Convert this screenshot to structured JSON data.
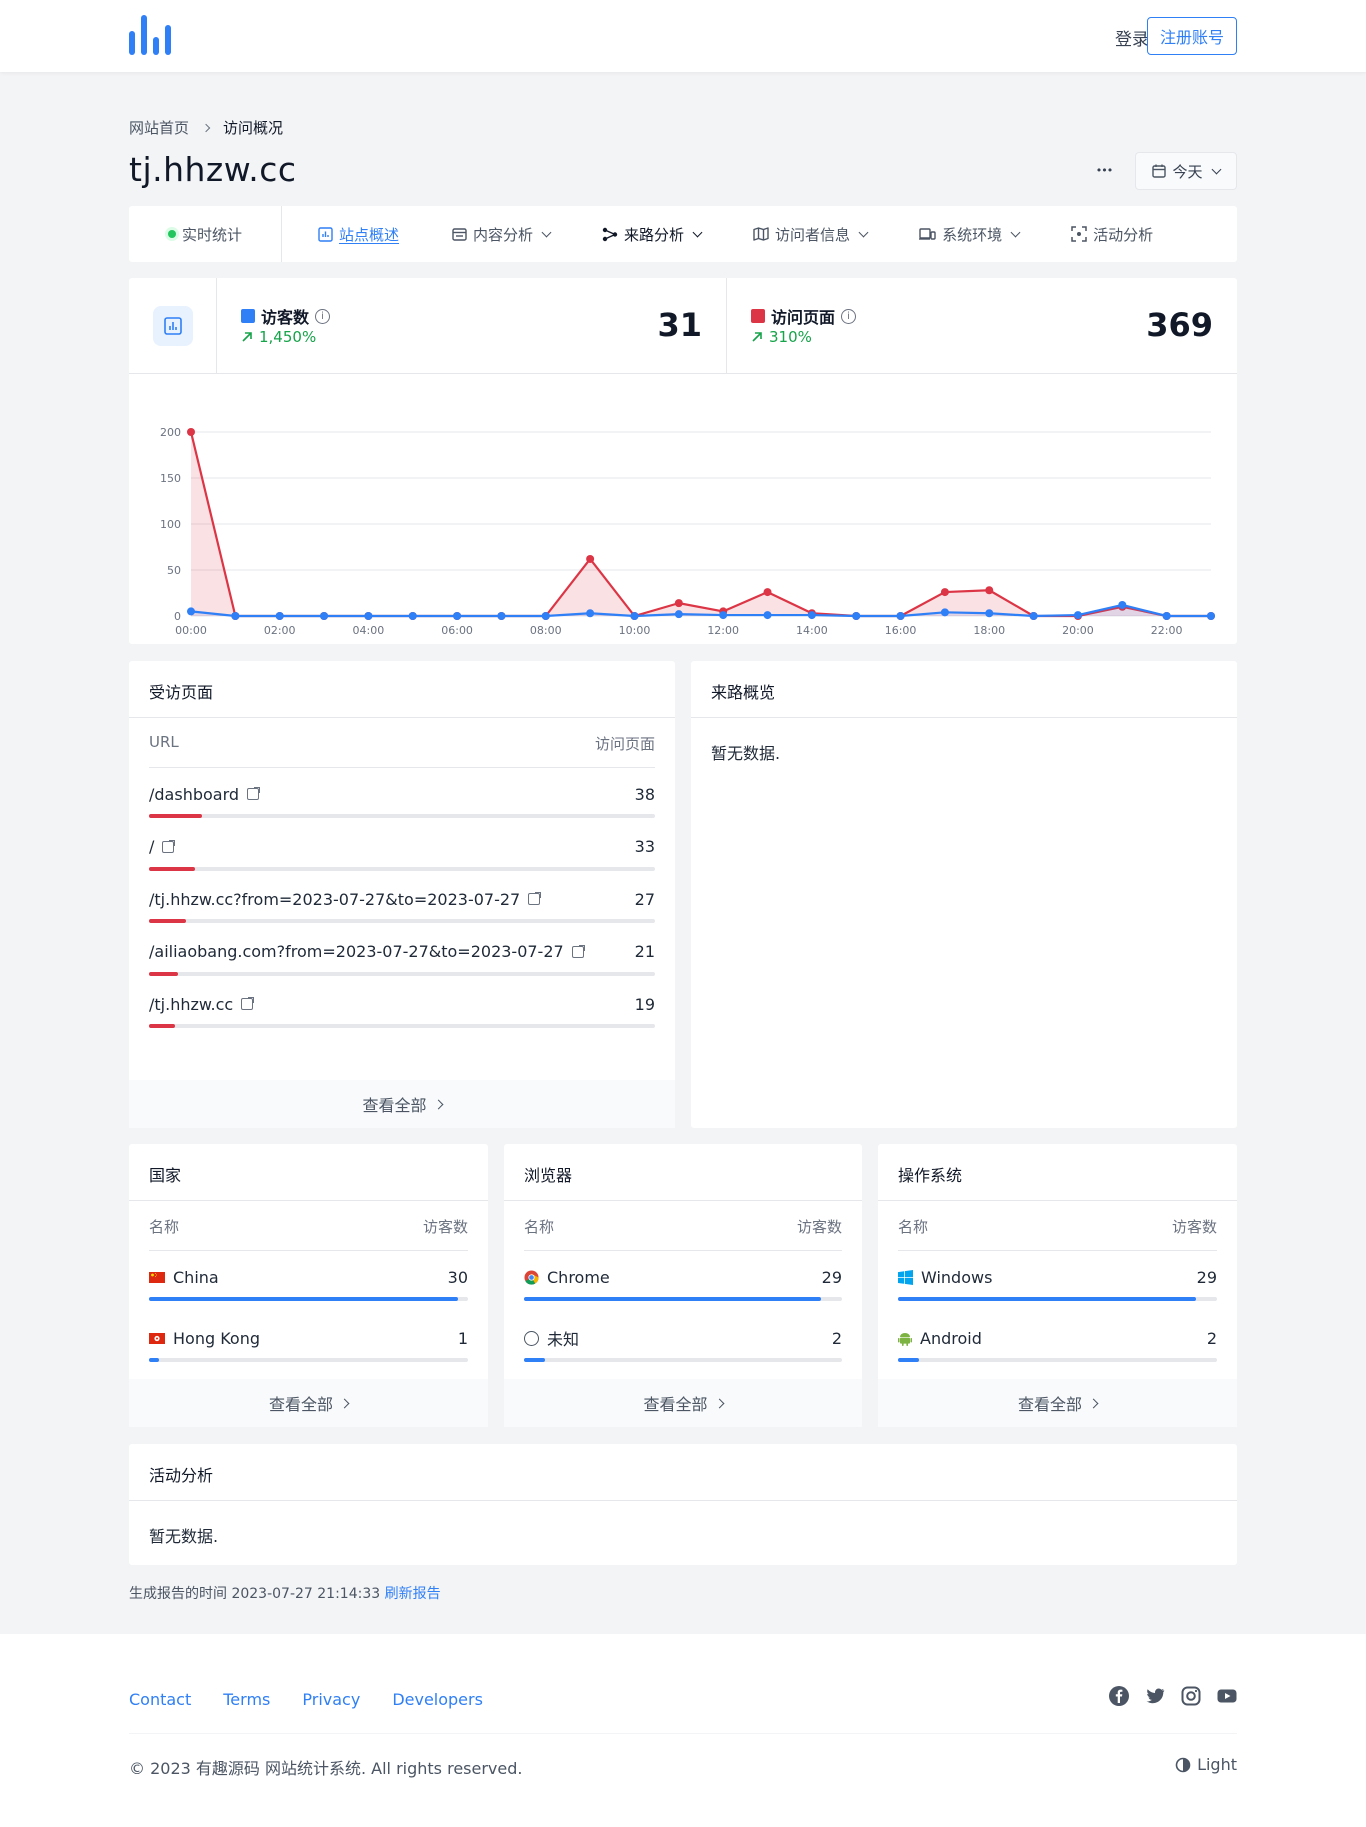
{
  "header": {
    "login": "登录",
    "register": "注册账号"
  },
  "breadcrumb": {
    "home": "网站首页",
    "current": "访问概况"
  },
  "page": {
    "title": "tj.hhzw.cc",
    "more": "•••",
    "date_range": "今天"
  },
  "nav": {
    "realtime": "实时统计",
    "overview": "站点概述",
    "content": "内容分析",
    "referrer": "来路分析",
    "visitors": "访问者信息",
    "system": "系统环境",
    "activity": "活动分析"
  },
  "stats": {
    "visitors": {
      "label": "访客数",
      "change": "1,450%",
      "value": "31",
      "color": "#2f7ff6"
    },
    "pageviews": {
      "label": "访问页面",
      "change": "310%",
      "value": "369",
      "color": "#dc3545"
    }
  },
  "chart_data": {
    "type": "line",
    "x": [
      "00:00",
      "01:00",
      "02:00",
      "03:00",
      "04:00",
      "05:00",
      "06:00",
      "07:00",
      "08:00",
      "09:00",
      "10:00",
      "11:00",
      "12:00",
      "13:00",
      "14:00",
      "15:00",
      "16:00",
      "17:00",
      "18:00",
      "19:00",
      "20:00",
      "21:00",
      "22:00",
      "23:00"
    ],
    "xticks": [
      "00:00",
      "02:00",
      "04:00",
      "06:00",
      "08:00",
      "10:00",
      "12:00",
      "14:00",
      "16:00",
      "18:00",
      "20:00",
      "22:00"
    ],
    "yticks": [
      0,
      50,
      100,
      150,
      200
    ],
    "ylim": [
      0,
      200
    ],
    "series": [
      {
        "name": "访问页面",
        "color": "#dc3545",
        "values": [
          200,
          0,
          0,
          0,
          0,
          0,
          0,
          0,
          0,
          62,
          0,
          14,
          5,
          26,
          3,
          0,
          0,
          26,
          28,
          0,
          0,
          10,
          0,
          0
        ]
      },
      {
        "name": "访客数",
        "color": "#2f7ff6",
        "values": [
          5,
          0,
          0,
          0,
          0,
          0,
          0,
          0,
          0,
          3,
          0,
          2,
          1,
          1,
          1,
          0,
          0,
          4,
          3,
          0,
          1,
          12,
          0,
          0
        ]
      }
    ]
  },
  "pages_panel": {
    "title": "受访页面",
    "col_url": "URL",
    "col_views": "访问页面",
    "rows": [
      {
        "url": "/dashboard",
        "count": "38",
        "pct": 0.104
      },
      {
        "url": "/",
        "count": "33",
        "pct": 0.09
      },
      {
        "url": "/tj.hhzw.cc?from=2023-07-27&to=2023-07-27",
        "count": "27",
        "pct": 0.073
      },
      {
        "url": "/ailiaobang.com?from=2023-07-27&to=2023-07-27",
        "count": "21",
        "pct": 0.057
      },
      {
        "url": "/tj.hhzw.cc",
        "count": "19",
        "pct": 0.051
      }
    ],
    "view_all": "查看全部"
  },
  "referrer_panel": {
    "title": "来路概览",
    "empty": "暂无数据."
  },
  "country_panel": {
    "title": "国家",
    "col_name": "名称",
    "col_count": "访客数",
    "rows": [
      {
        "name": "China",
        "count": "30",
        "pct": 0.968
      },
      {
        "name": "Hong Kong",
        "count": "1",
        "pct": 0.032
      }
    ],
    "view_all": "查看全部"
  },
  "browser_panel": {
    "title": "浏览器",
    "col_name": "名称",
    "col_count": "访客数",
    "rows": [
      {
        "name": "Chrome",
        "count": "29",
        "pct": 0.935
      },
      {
        "name": "未知",
        "count": "2",
        "pct": 0.065
      }
    ],
    "view_all": "查看全部"
  },
  "os_panel": {
    "title": "操作系统",
    "col_name": "名称",
    "col_count": "访客数",
    "rows": [
      {
        "name": "Windows",
        "count": "29",
        "pct": 0.935
      },
      {
        "name": "Android",
        "count": "2",
        "pct": 0.065
      }
    ],
    "view_all": "查看全部"
  },
  "activity_panel": {
    "title": "活动分析",
    "empty": "暂无数据."
  },
  "report": {
    "label": "生成报告的时间 2023-07-27 21:14:33",
    "refresh": "刷新报告"
  },
  "footer": {
    "links": {
      "contact": "Contact",
      "terms": "Terms",
      "privacy": "Privacy",
      "developers": "Developers"
    },
    "copyright": "© 2023 有趣源码 网站统计系统. All rights reserved.",
    "theme": "Light"
  },
  "colors": {
    "accent": "#2f7ff6",
    "pageviews": "#dc3545",
    "green": "#16a34a"
  }
}
